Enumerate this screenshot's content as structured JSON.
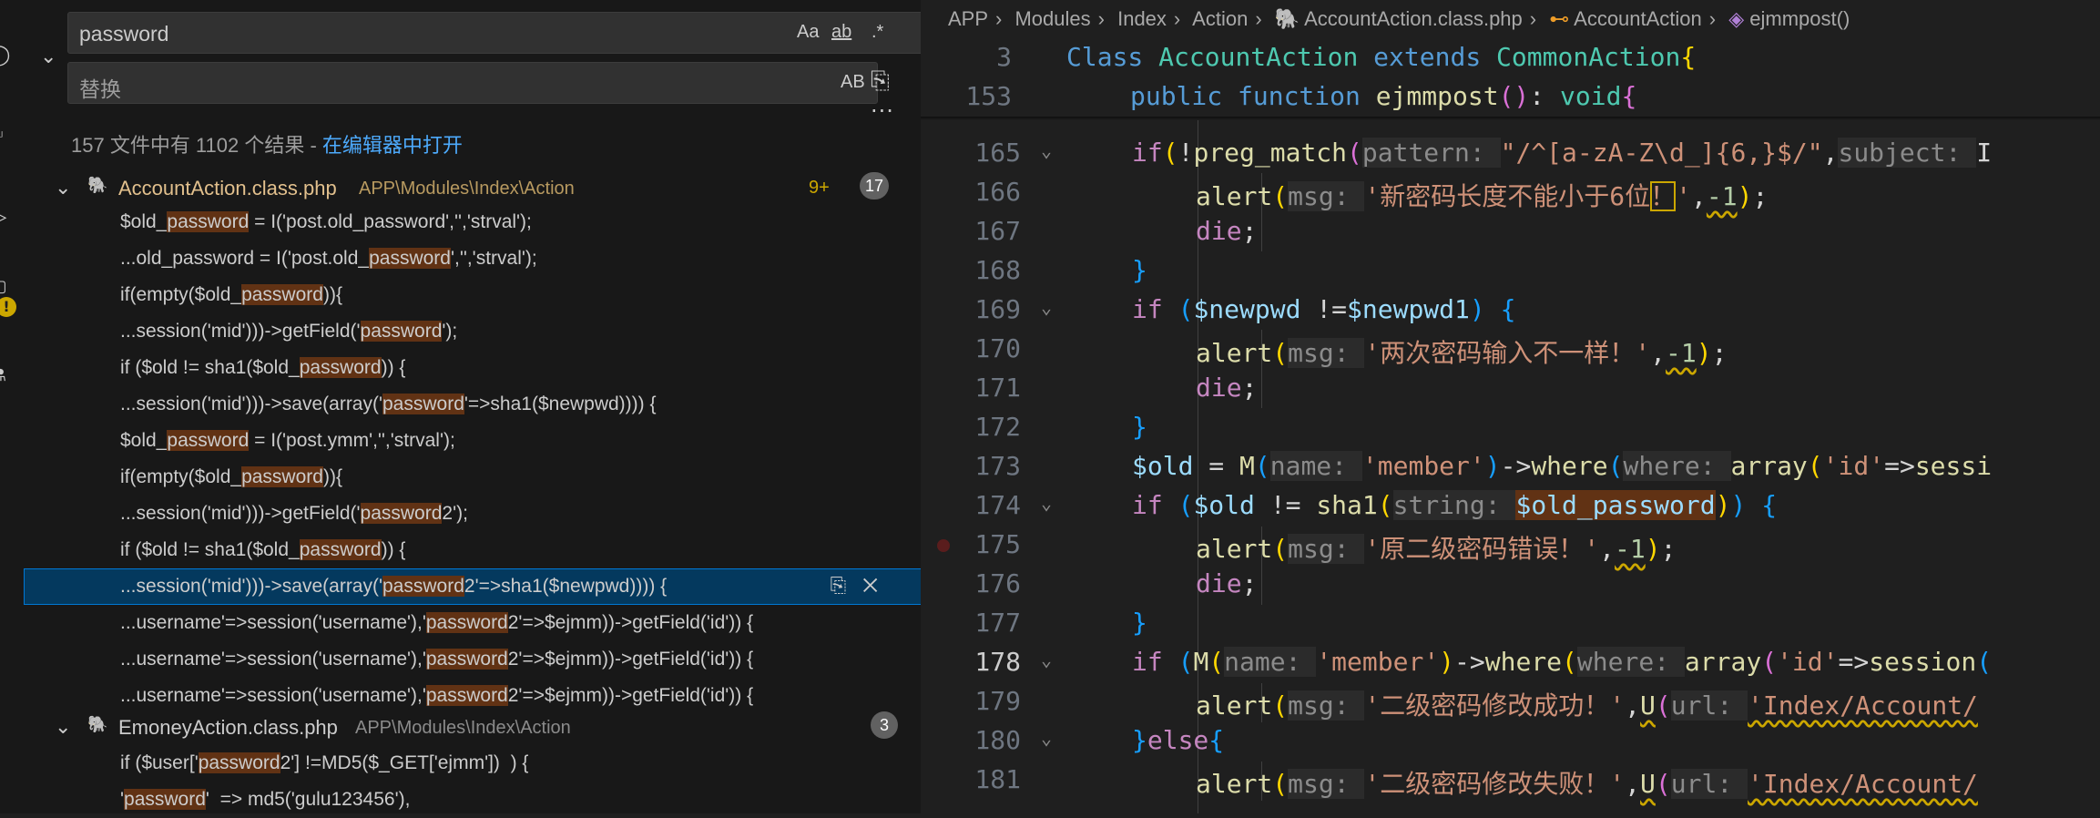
{
  "search": {
    "query": "password",
    "replace_placeholder": "替换",
    "opt_case": "Aa",
    "opt_word": "ab",
    "opt_regex": ".*",
    "opt_preserve_case": "AB",
    "summary_prefix": "157 文件中有 1102 个结果 - ",
    "summary_link": "在编辑器中打开"
  },
  "results": {
    "file1": {
      "name": "AccountAction.class.php",
      "path": "APP\\Modules\\Index\\Action",
      "badge_extra": "9+",
      "count": "17"
    },
    "file1_matches": [
      [
        "$old_",
        "password",
        " = I('post.old_password','','strval');",
        "",
        ""
      ],
      [
        "...old_password = I('post.old_",
        "password",
        "','','strval');",
        "",
        ""
      ],
      [
        "if(empty($old_",
        "password",
        ")){",
        "",
        ""
      ],
      [
        "...session('mid')))->getField('",
        "password",
        "');",
        "",
        ""
      ],
      [
        "if ($old != sha1($old_",
        "password",
        ")) {",
        "",
        ""
      ],
      [
        "...session('mid')))->save(array('",
        "password",
        "'=>sha1($newpwd)))) {",
        "",
        ""
      ],
      [
        "$old_",
        "password",
        " = I('post.ymm','','strval');",
        "",
        ""
      ],
      [
        "if(empty($old_",
        "password",
        ")){",
        "",
        ""
      ],
      [
        "...session('mid')))->getField('",
        "password",
        "2');",
        "",
        ""
      ],
      [
        "if ($old != sha1($old_",
        "password",
        ")) {",
        "",
        ""
      ],
      [
        "...session('mid')))->save(array('",
        "password",
        "2'=>sha1($newpwd)))) {",
        "",
        ""
      ],
      [
        "...username'=>session('username'),'",
        "password",
        "2'=>$ejmm))->getField('id')) {",
        "",
        ""
      ],
      [
        "...username'=>session('username'),'",
        "password",
        "2'=>$ejmm))->getField('id')) {",
        "",
        ""
      ],
      [
        "...username'=>session('username'),'",
        "password",
        "2'=>$ejmm))->getField('id')) {",
        "",
        ""
      ]
    ],
    "file2": {
      "name": "EmoneyAction.class.php",
      "path": "APP\\Modules\\Index\\Action",
      "count": "3"
    },
    "file2_matches": [
      [
        "if ($user['",
        "password",
        "2'] !=MD5($_GET['ejmm'])  ) {",
        "",
        ""
      ],
      [
        "'",
        "password",
        "'  => md5('gulu123456'),",
        "",
        ""
      ]
    ]
  },
  "breadcrumb": [
    "APP",
    "Modules",
    "Index",
    "Action",
    "AccountAction.class.php",
    "AccountAction",
    "ejmmpost()"
  ],
  "editor": {
    "sticky": [
      {
        "ln": "3",
        "code": "Class AccountAction extends CommonAction{"
      },
      {
        "ln": "153",
        "code": "public function ejmmpost(): void{"
      }
    ],
    "line_numbers": [
      "165",
      "166",
      "167",
      "168",
      "169",
      "170",
      "171",
      "172",
      "173",
      "174",
      "175",
      "176",
      "177",
      "178",
      "179",
      "180",
      "181"
    ],
    "code_text": {
      "l165": "if(!preg_match(pattern: \"/^[a-zA-Z\\d_]{6,}$/\",subject: I",
      "l166": "alert(msg: '新密码长度不能小于6位！',-1);",
      "l167": "die;",
      "l168": "}",
      "l169": "if ($newpwd !=$newpwd1) {",
      "l170": "alert(msg: '两次密码输入不一样！',-1);",
      "l171": "die;",
      "l172": "}",
      "l173": "$old = M(name: 'member')->where(where: array('id'=>sessi",
      "l174": "if ($old != sha1(string: $old_password)) {",
      "l175": "alert(msg: '原二级密码错误！',-1);",
      "l176": "die;",
      "l177": "}",
      "l178": "if (M(name: 'member')->where(where: array('id'=>session(",
      "l179": "alert(msg: '二级密码修改成功！',U(url: 'Index/Account/",
      "l180": "}else{",
      "l181": "alert(msg: '二级密码修改失败！',U(url: 'Index/Account/"
    }
  }
}
